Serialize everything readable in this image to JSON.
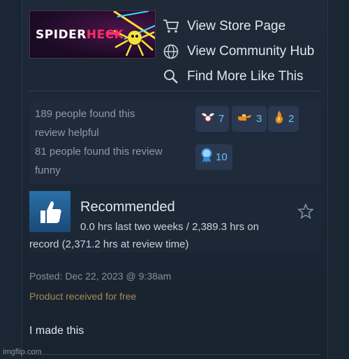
{
  "game": {
    "capsule_title_part1": "SPIDER",
    "capsule_title_part2": "HECK"
  },
  "links": [
    {
      "label": "View Store Page",
      "icon": "cart-icon"
    },
    {
      "label": "View Community Hub",
      "icon": "globe-icon"
    },
    {
      "label": "Find More Like This",
      "icon": "search-icon"
    }
  ],
  "helpful": {
    "helpful_text": "189 people found this review helpful",
    "funny_text": "81 people found this review funny"
  },
  "awards": [
    {
      "icon": "wings-award-icon",
      "count": "7"
    },
    {
      "icon": "pointing-hand-award-icon",
      "count": "3"
    },
    {
      "icon": "flame-award-icon",
      "count": "2"
    },
    {
      "icon": "ribbon-award-icon",
      "count": "10"
    }
  ],
  "review": {
    "verdict": "Recommended",
    "hours_line1": "0.0 hrs last two weeks / 2,389.3 hrs on",
    "hours_line2": "record (2,371.2 hrs at review time)",
    "posted": "Posted: Dec 22, 2023 @ 9:38am",
    "product_note": "Product received for free",
    "body": "I made this"
  },
  "watermark": "imgflip.com",
  "colors": {
    "accent": "#66c0f4",
    "background": "#1b2634",
    "free_note": "#a38b52"
  }
}
